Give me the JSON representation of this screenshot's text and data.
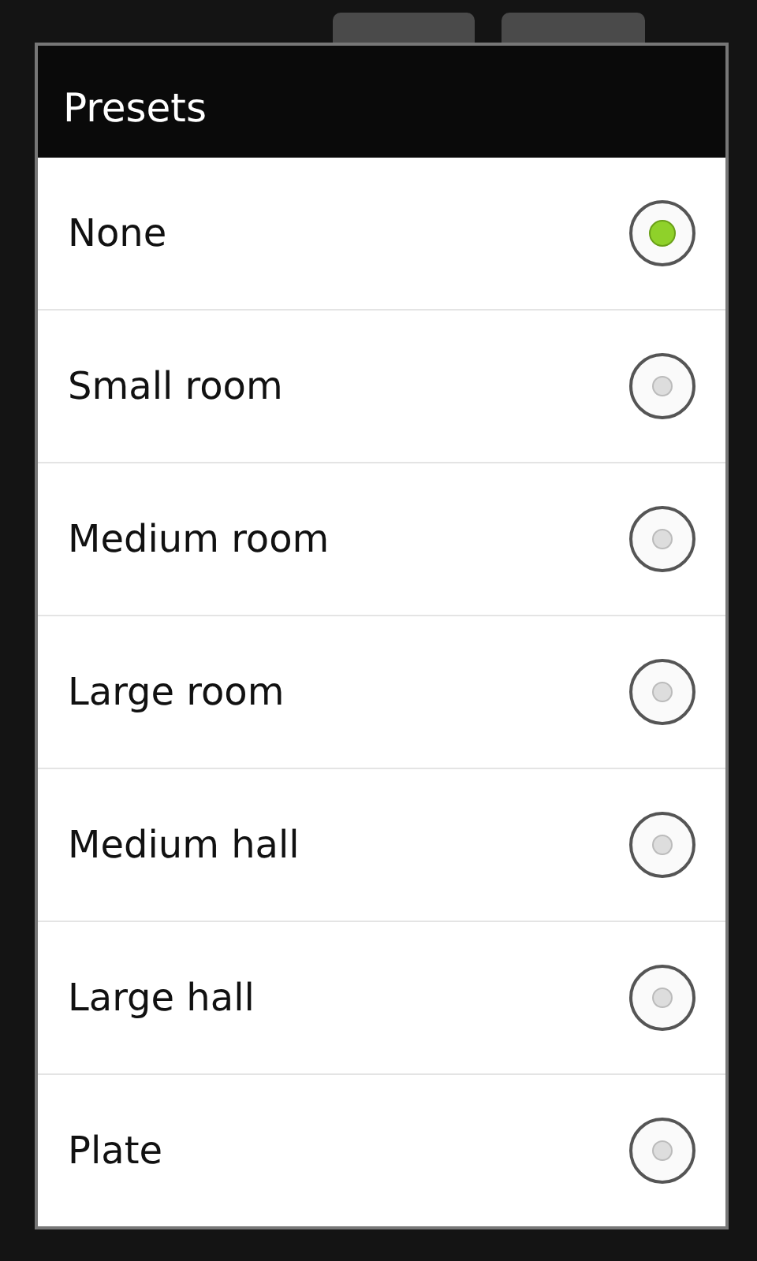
{
  "dialog": {
    "title": "Presets",
    "options": [
      {
        "label": "None",
        "selected": true
      },
      {
        "label": "Small room",
        "selected": false
      },
      {
        "label": "Medium room",
        "selected": false
      },
      {
        "label": "Large room",
        "selected": false
      },
      {
        "label": "Medium hall",
        "selected": false
      },
      {
        "label": "Large hall",
        "selected": false
      },
      {
        "label": "Plate",
        "selected": false
      }
    ]
  }
}
